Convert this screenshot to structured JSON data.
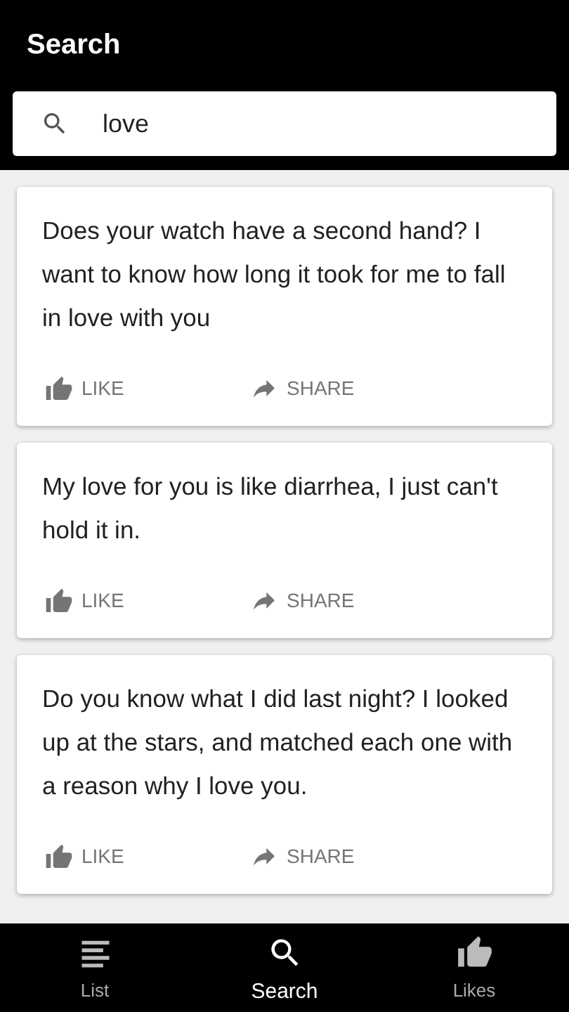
{
  "header": {
    "title": "Search"
  },
  "search": {
    "value": "love"
  },
  "cards": [
    {
      "text": "Does your watch have a second hand? I want to know how long it took for me to fall in love with you",
      "actions": [
        "LIKE",
        "SHARE"
      ]
    },
    {
      "text": "My love for you is like diarrhea, I just can't hold it in.",
      "actions": [
        "LIKE",
        "SHARE"
      ]
    },
    {
      "text": "Do you know what I did last night? I looked up at the stars, and matched each one with a reason why I love you.",
      "actions": [
        "LIKE",
        "SHARE"
      ]
    }
  ],
  "bottom_nav": [
    {
      "label": "List",
      "kind": "list",
      "selected": false
    },
    {
      "label": "Search",
      "kind": "search",
      "selected": true
    },
    {
      "label": "Likes",
      "kind": "like",
      "selected": false
    }
  ]
}
